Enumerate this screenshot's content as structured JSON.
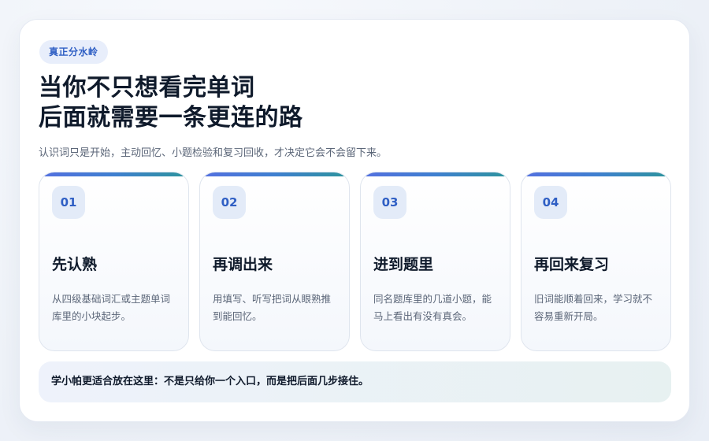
{
  "badge": "真正分水岭",
  "title_line1": "当你不只想看完单词",
  "title_line2": "后面就需要一条更连的路",
  "subtitle": "认识词只是开始，主动回忆、小题检验和复习回收，才决定它会不会留下来。",
  "steps": [
    {
      "num": "01",
      "title": "先认熟",
      "desc": "从四级基础词汇或主题单词库里的小块起步。"
    },
    {
      "num": "02",
      "title": "再调出来",
      "desc": "用填写、听写把词从眼熟推到能回忆。"
    },
    {
      "num": "03",
      "title": "进到题里",
      "desc": "同名题库里的几道小题，能马上看出有没有真会。"
    },
    {
      "num": "04",
      "title": "再回来复习",
      "desc": "旧词能顺着回来，学习就不容易重新开局。"
    }
  ],
  "footer": "学小帕更适合放在这里：不是只给你一个入口，而是把后面几步接住。",
  "colors": {
    "accent": "#2f5fc4",
    "bar_start": "#5470e0",
    "bar_end": "#2c949c",
    "heading": "#0f1a2b"
  }
}
